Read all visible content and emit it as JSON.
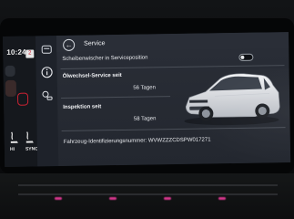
{
  "status": {
    "clock": "10:24",
    "profile_badge": "2"
  },
  "climate": {
    "left_label": "HI",
    "right_label": "SYNC"
  },
  "header": {
    "back_icon": "back-arrow-icon",
    "title": "Service"
  },
  "wiper_row": {
    "label": "Scheibenwischer in Serviceposition",
    "toggle_state": "off"
  },
  "oil_service": {
    "label": "Ölwechsel-Service seit",
    "value": "56 Tagen"
  },
  "inspection": {
    "label": "Inspektion seit",
    "value": "58 Tagen"
  },
  "vin": {
    "text": "Fahrzeug-Identifizierungsnummer: WVWZZZCDSPW017271"
  },
  "colors": {
    "accent": "#c12233",
    "screen_bg": "#23272f",
    "text": "#f0f2f5"
  }
}
